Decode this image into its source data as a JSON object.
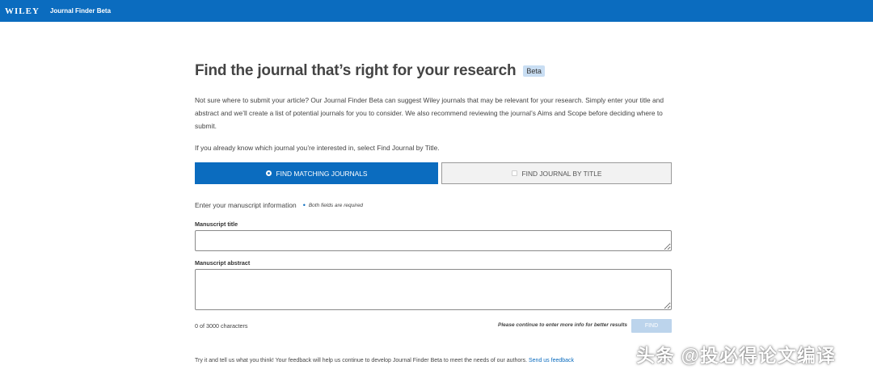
{
  "header": {
    "logo": "WILEY",
    "product": "Journal Finder Beta",
    "bar_color": "#0b6cbf"
  },
  "main": {
    "title": "Find the journal that’s right for your research",
    "badge": "Beta",
    "intro": "Not sure where to submit your article? Our Journal Finder Beta can suggest Wiley journals that may be relevant for your research. Simply enter your title and abstract and we’ll create a list of potential journals for you to consider. We also recommend reviewing the journal’s Aims and Scope before deciding where to submit.",
    "known_journal_text": "If you already know which journal you’re interested in, select Find Journal by Title.",
    "tabs": [
      {
        "label": "FIND MATCHING JOURNALS",
        "selected": true
      },
      {
        "label": "FIND JOURNAL BY TITLE",
        "selected": false
      }
    ],
    "section_title": "Enter your manuscript information",
    "required_note": "Both fields are required",
    "manuscript_title_label": "Manuscript title",
    "manuscript_title_value": "",
    "manuscript_abstract_label": "Manuscript abstract",
    "manuscript_abstract_value": "",
    "char_count": "0 of 3000 characters",
    "continue_note": "Please continue to enter more info for better results",
    "find_button": "FIND",
    "feedback_text": "Try it and tell us what you think! Your feedback will help us continue to develop Journal Finder Beta to meet the needs of our authors.",
    "feedback_link": "Send us feedback"
  },
  "watermark": "头条 @投必得论文编译"
}
